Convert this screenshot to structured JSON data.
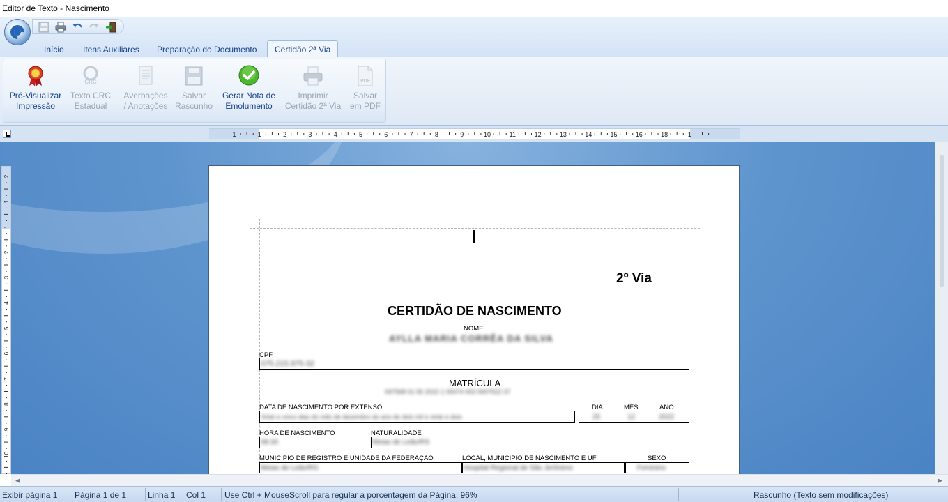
{
  "window": {
    "title": "Editor de Texto - Nascimento"
  },
  "tabs": [
    {
      "label": "Início",
      "active": false
    },
    {
      "label": "Itens Auxiliares",
      "active": false
    },
    {
      "label": "Preparação do Documento",
      "active": false
    },
    {
      "label": "Certidão 2ª Via",
      "active": true
    }
  ],
  "ribbon": {
    "buttons": [
      {
        "line1": "Pré-Visualizar",
        "line2": "Impressão",
        "icon": "award-ribbon-icon",
        "enabled": true
      },
      {
        "line1": "Texto CRC",
        "line2": "Estadual",
        "icon": "crc-logo-icon",
        "enabled": false
      },
      {
        "line1": "Averbações",
        "line2": "/ Anotações",
        "icon": "document-icon",
        "enabled": false
      },
      {
        "line1": "Salvar",
        "line2": "Rascunho",
        "icon": "save-icon",
        "enabled": false
      },
      {
        "line1": "Gerar Nota de",
        "line2": "Emolumento",
        "icon": "green-check-icon",
        "enabled": true
      },
      {
        "line1": "Imprimir",
        "line2": "Certidão 2ª Via",
        "icon": "printer-icon",
        "enabled": false
      },
      {
        "line1": "Salvar",
        "line2": "em PDF",
        "icon": "pdf-icon",
        "enabled": false
      }
    ]
  },
  "ruler": {
    "numbers": [
      "1",
      "1",
      "2",
      "3",
      "4",
      "5",
      "6",
      "7",
      "8",
      "9",
      "10",
      "11",
      "12",
      "13",
      "14",
      "15",
      "16",
      "18",
      "1"
    ]
  },
  "vruler": {
    "numbers": [
      "2",
      "1",
      "1",
      "2",
      "3",
      "4",
      "5",
      "6",
      "7",
      "8",
      "9",
      "10"
    ]
  },
  "document": {
    "via": "2º Via",
    "title": "CERTIDÃO DE NASCIMENTO",
    "nome_label": "NOME",
    "nome_value": "AYLLA MARIA CORRÊA DA SILVA",
    "cpf_label": "CPF",
    "cpf_value": "075.215.975-32",
    "matricula_label": "MATRÍCULA",
    "matricula_value": "097568 01 55 2022 1 00074 003 0007522 37",
    "data_extenso_label": "DATA DE NASCIMENTO POR EXTENSO",
    "data_extenso_value": "Vinte e cinco dias do mês de dezembro do ano de dois mil e vinte e dois",
    "dia_label": "DIA",
    "mes_label": "MÊS",
    "ano_label": "ANO",
    "dia_value": "25",
    "mes_value": "12",
    "ano_value": "2022",
    "hora_label": "HORA DE NASCIMENTO",
    "hora_value": "08:30",
    "naturalidade_label": "NATURALIDADE",
    "naturalidade_value": "Meias de Leão/RS",
    "municipio_label": "MUNICÍPIO DE REGISTRO E UNIDADE DA FEDERAÇÃO",
    "municipio_value": "Meias de Leão/RS",
    "local_label": "LOCAL, MUNICÍPIO DE NASCIMENTO E UF",
    "local_value": "Hospital Regional de São Jerônimo",
    "sexo_label": "SEXO",
    "sexo_value": "Feminino"
  },
  "status": {
    "exibir": "Exibir página 1",
    "pagina": "Página 1 de 1",
    "linha": "Linha 1",
    "col": "Col 1",
    "hint": "Use Ctrl + MouseScroll para regular a porcentagem da Página: 96%",
    "state": "Rascunho (Texto sem modificações)"
  }
}
